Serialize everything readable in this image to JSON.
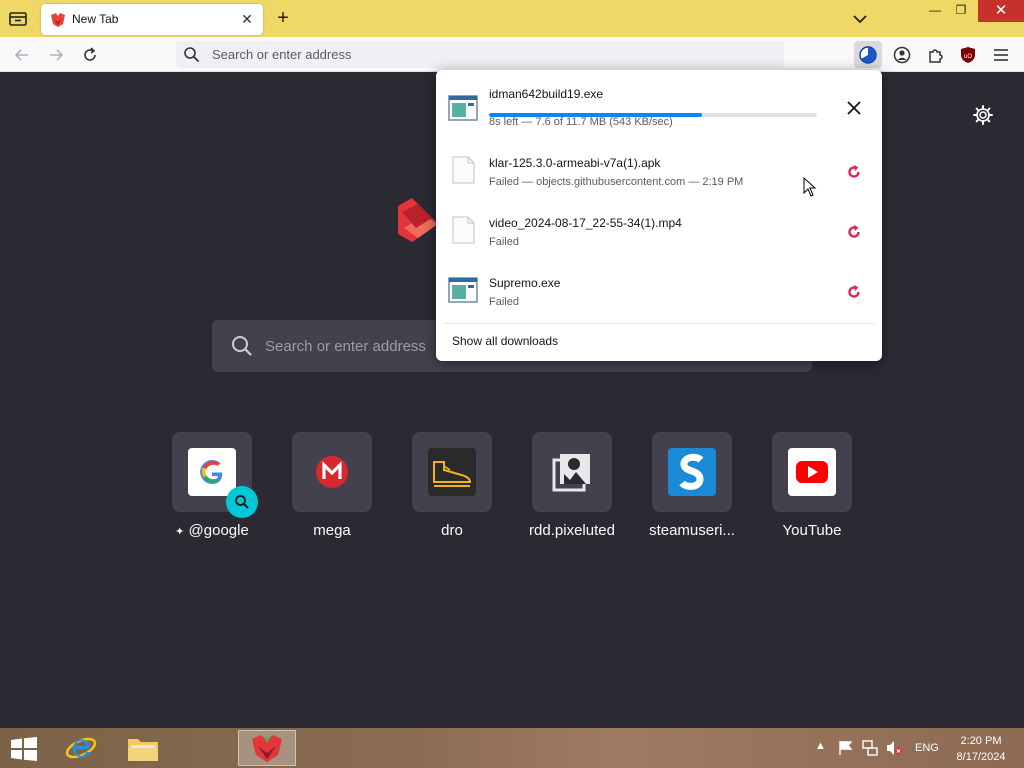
{
  "browser": {
    "tab_title": "New Tab",
    "address_placeholder": "Search or enter address",
    "tab_close_glyph": "✕",
    "new_tab_glyph": "+"
  },
  "window_controls": {
    "minimize": "—",
    "restore": "❐",
    "close": "✕"
  },
  "newtab": {
    "search_placeholder": "Search or enter address",
    "top_sites": [
      {
        "label": "@google",
        "icon": "google-icon"
      },
      {
        "label": "mega",
        "icon": "mega-icon"
      },
      {
        "label": "dro",
        "icon": "dro-icon"
      },
      {
        "label": "rdd.pixeluted",
        "icon": "rdd-icon"
      },
      {
        "label": "steamuseri...",
        "icon": "steam-icon"
      },
      {
        "label": "YouTube",
        "icon": "youtube-icon"
      }
    ]
  },
  "downloads": {
    "items": [
      {
        "name": "idman642build19.exe",
        "status": "8s left — 7.6 of 11.7 MB (543 KB/sec)",
        "progress": 0.65,
        "icon": "exe-file-icon",
        "action": "cancel"
      },
      {
        "name": "klar-125.3.0-armeabi-v7a(1).apk",
        "status": "Failed — objects.githubusercontent.com — 2:19 PM",
        "icon": "generic-file-icon",
        "action": "retry"
      },
      {
        "name": "video_2024-08-17_22-55-34(1).mp4",
        "status": "Failed",
        "icon": "generic-file-icon",
        "action": "retry"
      },
      {
        "name": "Supremo.exe",
        "status": "Failed",
        "icon": "exe-file-icon",
        "action": "retry"
      }
    ],
    "show_all": "Show all downloads"
  },
  "taskbar": {
    "lang": "ENG",
    "time": "2:20 PM",
    "date": "8/17/2024"
  },
  "colors": {
    "tabbar": "#f0d867",
    "page_bg": "#2b2a33",
    "tile_bg": "#42414d",
    "retry_red": "#e22850",
    "progress_blue": "#0a84ff"
  }
}
